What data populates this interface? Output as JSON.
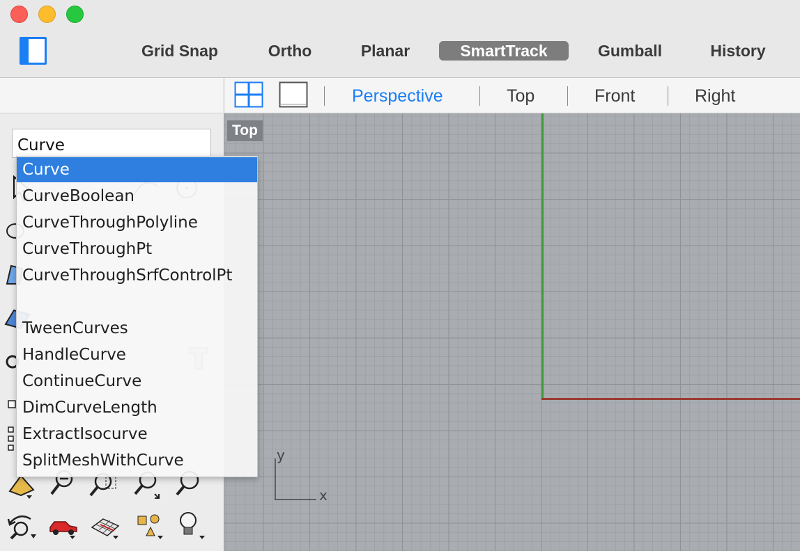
{
  "toolbar": {
    "modes": [
      {
        "label": "Grid Snap",
        "active": false
      },
      {
        "label": "Ortho",
        "active": false
      },
      {
        "label": "Planar",
        "active": false
      },
      {
        "label": "SmartTrack",
        "active": true
      },
      {
        "label": "Gumball",
        "active": false
      },
      {
        "label": "History",
        "active": false
      }
    ]
  },
  "left_panel": {
    "command_input": {
      "value": "Curve",
      "placeholder": ""
    }
  },
  "autocomplete": {
    "selected_index": 0,
    "items": [
      "Curve",
      "CurveBoolean",
      "CurveThroughPolyline",
      "CurveThroughPt",
      "CurveThroughSrfControlPt",
      "",
      "TweenCurves",
      "HandleCurve",
      "ContinueCurve",
      "DimCurveLength",
      "ExtractIsocurve",
      "SplitMeshWithCurve"
    ]
  },
  "view_tabs": {
    "layout_icons": [
      "four-viewports-icon",
      "single-viewport-icon"
    ],
    "tabs": [
      {
        "label": "Perspective",
        "active": true
      },
      {
        "label": "Top",
        "active": false
      },
      {
        "label": "Front",
        "active": false
      },
      {
        "label": "Right",
        "active": false
      }
    ]
  },
  "viewport": {
    "label": "Top",
    "axis_labels": {
      "x": "x",
      "y": "y"
    },
    "colors": {
      "x_axis": "#9a3b32",
      "y_axis": "#3f9a3a",
      "grid": "#a9acb0"
    }
  },
  "colors": {
    "accent": "#1a7ef5",
    "selection": "#2e7fe0"
  }
}
